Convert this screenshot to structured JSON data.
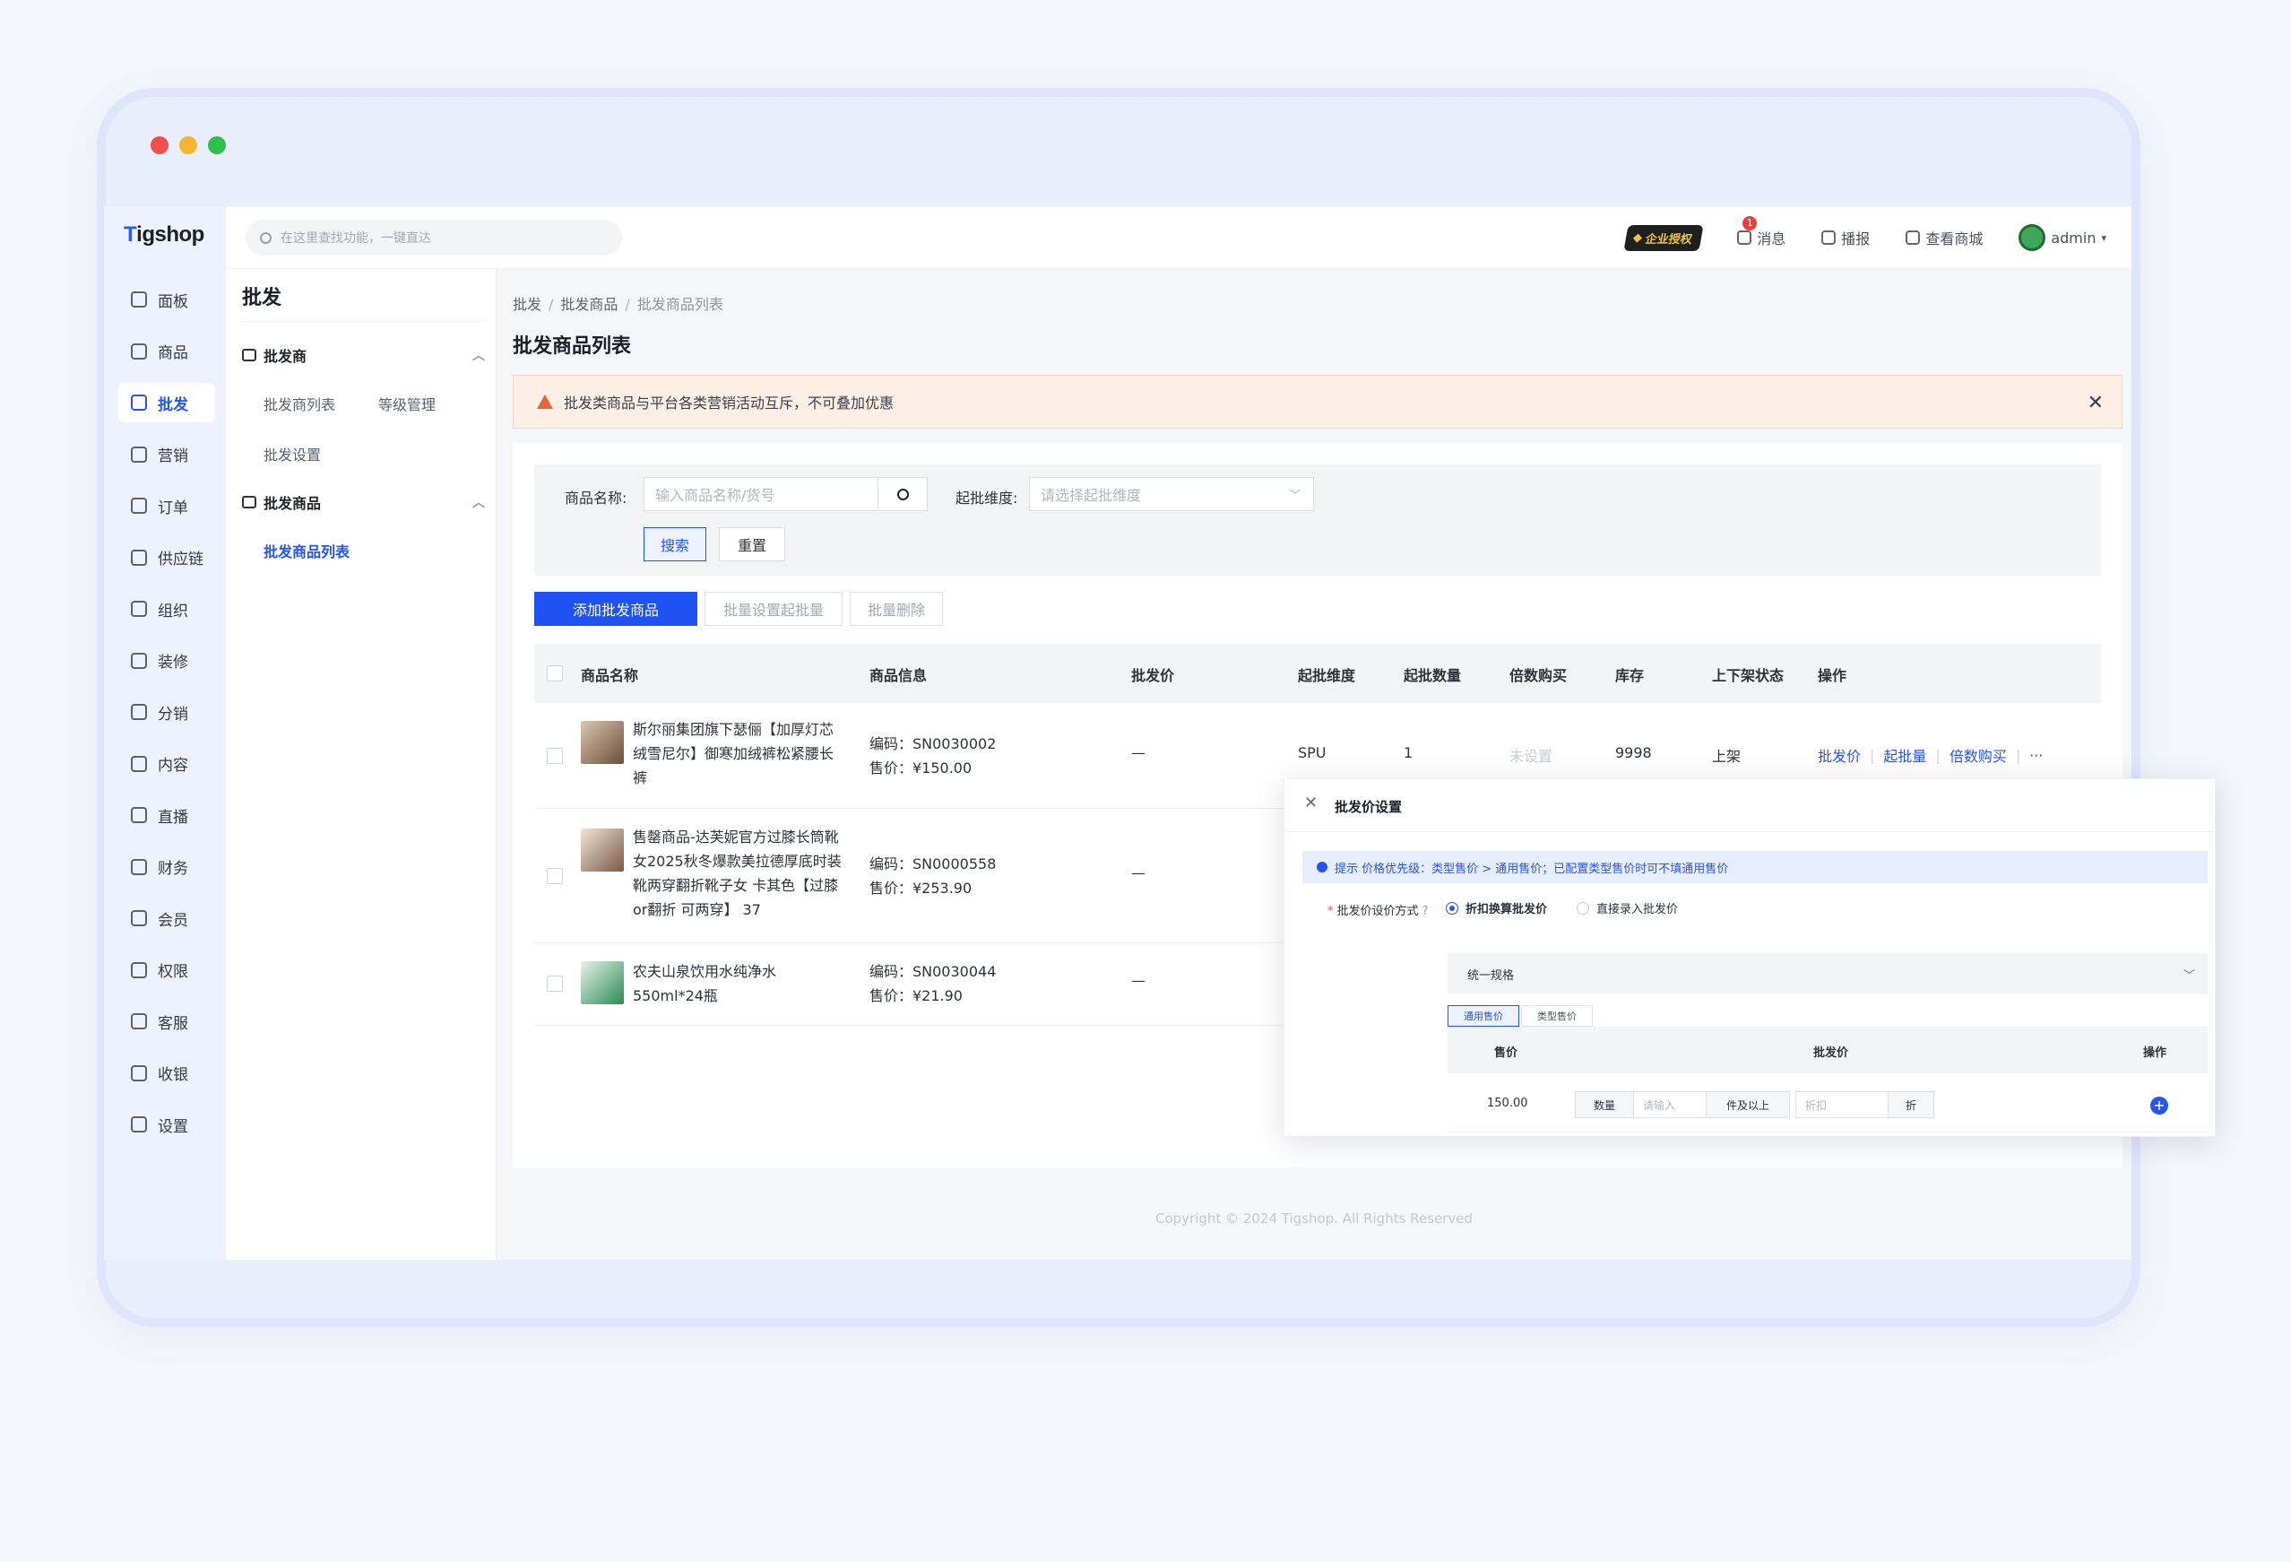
{
  "brand": {
    "logo_t": "T",
    "logo_rest": "igshop"
  },
  "rail": [
    {
      "label": "面板",
      "icon": "dashboard-icon"
    },
    {
      "label": "商品",
      "icon": "box-icon"
    },
    {
      "label": "批发",
      "icon": "store-icon",
      "active": true
    },
    {
      "label": "营销",
      "icon": "marketing-icon"
    },
    {
      "label": "订单",
      "icon": "order-icon"
    },
    {
      "label": "供应链",
      "icon": "supply-icon"
    },
    {
      "label": "组织",
      "icon": "org-icon"
    },
    {
      "label": "装修",
      "icon": "decor-icon"
    },
    {
      "label": "分销",
      "icon": "distribution-icon"
    },
    {
      "label": "内容",
      "icon": "content-icon"
    },
    {
      "label": "直播",
      "icon": "live-icon"
    },
    {
      "label": "财务",
      "icon": "finance-icon"
    },
    {
      "label": "会员",
      "icon": "member-icon"
    },
    {
      "label": "权限",
      "icon": "permission-icon"
    },
    {
      "label": "客服",
      "icon": "service-icon"
    },
    {
      "label": "收银",
      "icon": "cashier-icon"
    },
    {
      "label": "设置",
      "icon": "settings-icon"
    }
  ],
  "sub": {
    "title": "批发",
    "group1": "批发商",
    "group1_links": [
      "批发商列表",
      "等级管理",
      "批发设置"
    ],
    "group2": "批发商品",
    "group2_links": [
      "批发商品列表"
    ]
  },
  "topbar": {
    "search_placeholder": "在这里查找功能，一键直达",
    "enterprise_badge": "企业授权",
    "messages": "消息",
    "message_count": "1",
    "broadcast": "播报",
    "view_store": "查看商城",
    "user": "admin"
  },
  "breadcrumb": [
    "批发",
    "批发商品",
    "批发商品列表"
  ],
  "page_title": "批发商品列表",
  "alert": "批发类商品与平台各类营销活动互斥，不可叠加优惠",
  "filter": {
    "name_label": "商品名称:",
    "name_placeholder": "输入商品名称/货号",
    "dim_label": "起批维度:",
    "dim_placeholder": "请选择起批维度",
    "search_btn": "搜索",
    "reset_btn": "重置"
  },
  "actions": {
    "add": "添加批发商品",
    "batch_set": "批量设置起批量",
    "batch_delete": "批量删除"
  },
  "table": {
    "headers": [
      "商品名称",
      "商品信息",
      "批发价",
      "起批维度",
      "起批数量",
      "倍数购买",
      "库存",
      "上下架状态",
      "操作"
    ],
    "rows": [
      {
        "name": "斯尔丽集团旗下瑟俪【加厚灯芯绒雪尼尔】御寒加绒裤松紧腰长裤",
        "code": "编码：SN0030002",
        "price": "售价：¥150.00",
        "wholesale": "—",
        "dim": "SPU",
        "qty": "1",
        "multiple": "未设置",
        "stock": "9998",
        "status": "上架",
        "ops": [
          "批发价",
          "起批量",
          "倍数购买",
          "···"
        ]
      },
      {
        "name": "售罄商品-达芙妮官方过膝长筒靴女2025秋冬爆款美拉德厚底时装靴两穿翻折靴子女 卡其色【过膝or翻折 可两穿】 37",
        "code": "编码：SN0000558",
        "price": "售价：¥253.90",
        "wholesale": "—"
      },
      {
        "name": "农夫山泉饮用水纯净水550ml*24瓶",
        "code": "编码：SN0030044",
        "price": "售价：¥21.90",
        "wholesale": "—"
      }
    ]
  },
  "footer": "Copyright © 2024 Tigshop. All Rights Reserved",
  "drawer": {
    "title": "批发价设置",
    "tip": "提示 价格优先级：类型售价 > 通用售价；已配置类型售价时可不填通用售价",
    "method_label": "批发价设价方式",
    "option_discount": "折扣换算批发价",
    "option_direct": "直接录入批发价",
    "spec": "统一规格",
    "tab_general": "通用售价",
    "tab_type": "类型售价",
    "col_price": "售价",
    "col_wholesale": "批发价",
    "col_ops": "操作",
    "row_price": "150.00",
    "qty_addon": "数量",
    "qty_placeholder": "请输入",
    "qty_suffix": "件及以上",
    "discount_placeholder": "折扣",
    "discount_suffix": "折"
  }
}
